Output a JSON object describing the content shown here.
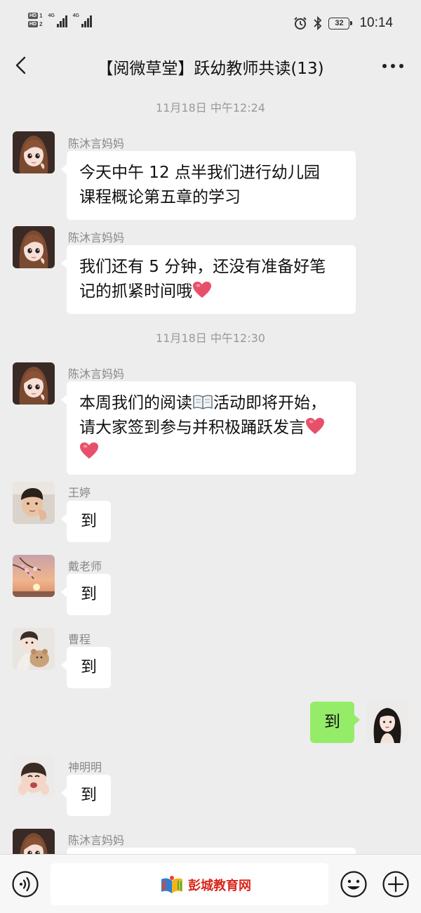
{
  "status_bar": {
    "sim1": "HD",
    "sim1_num": "1",
    "sim2": "HD",
    "sim2_num": "2",
    "network_1": "4G",
    "network_2": "4G",
    "battery": "32",
    "time": "10:14",
    "icons": [
      "alarm-icon",
      "bluetooth-icon",
      "battery-icon"
    ]
  },
  "header": {
    "title": "【阅微草堂】跃幼教师共读(13)",
    "icons": [
      "back-arrow-icon",
      "more-icon"
    ]
  },
  "chat": {
    "timestamps": [
      "11月18日 中午12:24",
      "11月18日 中午12:30"
    ],
    "messages": [
      {
        "sender": "陈沐言妈妈",
        "lines": [
          "今天中午 12 点半我们进行幼儿园",
          "课程概论第五章的学习"
        ]
      },
      {
        "sender": "陈沐言妈妈",
        "lines": [
          "我们还有 5 分钟，还没有准备好笔",
          "记的抓紧时间哦"
        ],
        "emoji": "heart"
      },
      {
        "sender": "陈沐言妈妈",
        "lines": [
          "本周我们的阅读",
          "活动即将开始，",
          "请大家签到参与并积极踊跃发言"
        ],
        "emoji": [
          "book",
          "heart",
          "heart"
        ]
      },
      {
        "sender": "王婷",
        "text": "到"
      },
      {
        "sender": "戴老师",
        "text": "到"
      },
      {
        "sender": "曹程",
        "text": "到"
      },
      {
        "sender": "me",
        "text": "到"
      },
      {
        "sender": "神明明",
        "text": "到"
      },
      {
        "sender": "陈沐言妈妈",
        "text": ""
      }
    ]
  },
  "input_bar": {
    "watermark": "彭城教育网",
    "icons": [
      "voice-icon",
      "emoji-icon",
      "plus-icon"
    ]
  },
  "colors": {
    "background": "#ededed",
    "my_bubble": "#95ec69",
    "other_bubble": "#ffffff",
    "watermark": "#d8261b"
  }
}
